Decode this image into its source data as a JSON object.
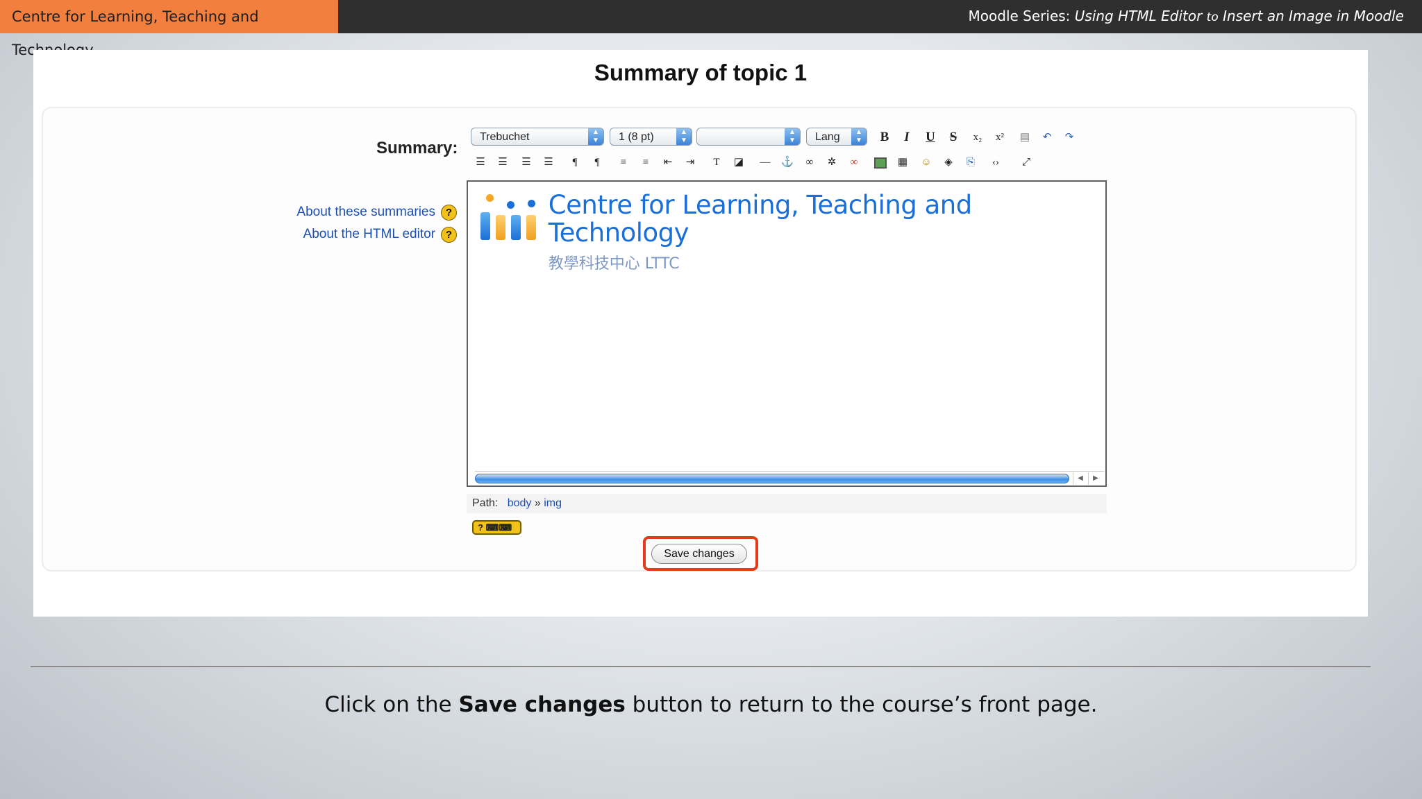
{
  "header": {
    "brand": "Centre for Learning, Teaching and Technology",
    "series_prefix": "Moodle Series:",
    "series_using": "Using HTML Editor",
    "series_to": "to",
    "series_title": "Insert an Image in Moodle"
  },
  "page": {
    "title": "Summary of topic 1",
    "summary_label": "Summary:",
    "help_links": [
      "About these summaries",
      "About the HTML editor"
    ],
    "help_icon": "?"
  },
  "toolbar": {
    "font_family": "Trebuchet",
    "font_size": "1 (8 pt)",
    "heading": "",
    "lang": "Lang",
    "bold": "B",
    "italic": "I",
    "underline": "U",
    "strike": "S"
  },
  "editor": {
    "logo_title": "Centre for Learning, Teaching and Technology",
    "logo_subtitle": "教學科技中心 LTTC"
  },
  "path": {
    "label": "Path:",
    "items": [
      "body",
      "img"
    ],
    "separator": "»"
  },
  "keyboard_toggle": "?",
  "save_button": "Save changes",
  "caption": {
    "before": "Click on the ",
    "bold": "Save changes",
    "after": " button to return to the course’s front page."
  },
  "colors": {
    "brand_bg": "#f37f3e",
    "topbar_bg": "#2f2f2f",
    "highlight": "#e23c1a",
    "link": "#1c4fb6"
  }
}
